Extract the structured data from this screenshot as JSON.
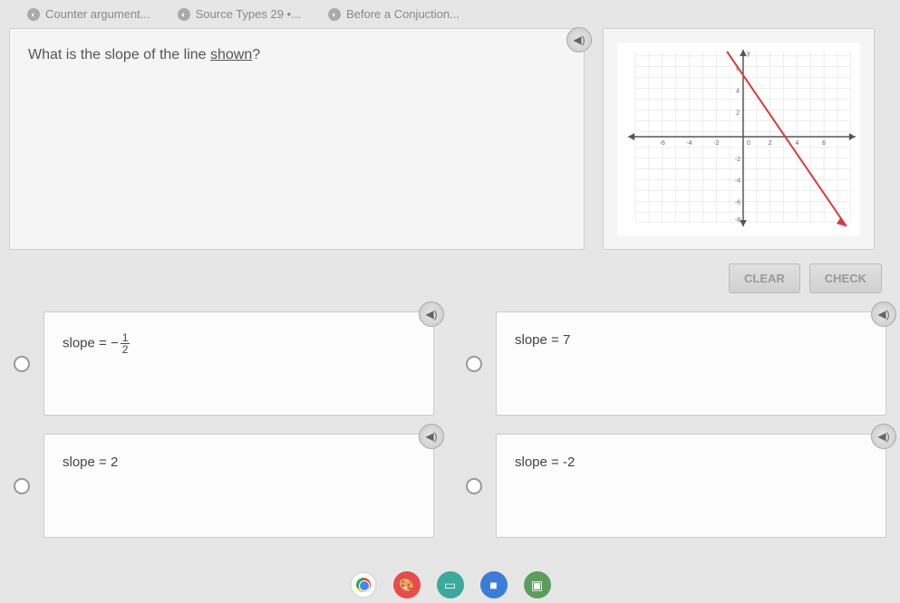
{
  "tabs": [
    {
      "label": "Counter argument..."
    },
    {
      "label": "Source Types 29 •..."
    },
    {
      "label": "Before a Conjuction..."
    }
  ],
  "question": {
    "prefix": "What is the slope of the line ",
    "link": "shown",
    "suffix": "?"
  },
  "buttons": {
    "clear": "CLEAR",
    "check": "CHECK"
  },
  "answers": {
    "a": {
      "prefix": "slope = −",
      "frac_num": "1",
      "frac_den": "2"
    },
    "b": {
      "text": "slope = 7"
    },
    "c": {
      "text": "slope = 2"
    },
    "d": {
      "text": "slope = -2"
    }
  },
  "chart_data": {
    "type": "line",
    "title": "",
    "xlabel": "",
    "ylabel": "y",
    "xlim": [
      -8,
      8
    ],
    "ylim": [
      -8,
      8
    ],
    "x_ticks": [
      -8,
      -6,
      -4,
      -2,
      0,
      2,
      4,
      6,
      8
    ],
    "y_ticks": [
      -8,
      -6,
      -4,
      -2,
      0,
      2,
      4,
      6,
      8
    ],
    "series": [
      {
        "name": "line",
        "points": [
          [
            -1,
            8
          ],
          [
            7,
            -8
          ]
        ],
        "slope": -2,
        "intercept": 6,
        "color": "#d63b3b"
      }
    ]
  }
}
